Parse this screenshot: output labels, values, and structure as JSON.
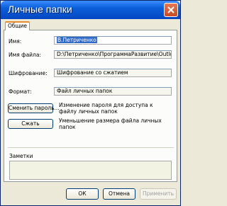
{
  "window": {
    "title": "Личные папки"
  },
  "tabs": [
    {
      "label": "Общие"
    }
  ],
  "fields": {
    "name": {
      "label": "Имя:",
      "value": "В.Петриченко"
    },
    "filename": {
      "label": "Имя файла:",
      "value": "D:\\Петриченко\\ПрограммаРазвитие\\Outlook\\"
    },
    "encryption": {
      "label": "Шифрование:",
      "value": "Шифрование со сжатием"
    },
    "format": {
      "label": "Формат:",
      "value": "Файл личных папок"
    }
  },
  "actions": {
    "change_password": {
      "label": "Сменить пароль...",
      "description": "Изменение пароля для доступа к файлу личных папок"
    },
    "compact": {
      "label": "Сжать",
      "description": "Уменьшение размера файла личных папок"
    }
  },
  "notes": {
    "label": "Заметки",
    "value": ""
  },
  "footer": {
    "ok": "ОК",
    "cancel": "Отмена",
    "apply": "Применить"
  }
}
